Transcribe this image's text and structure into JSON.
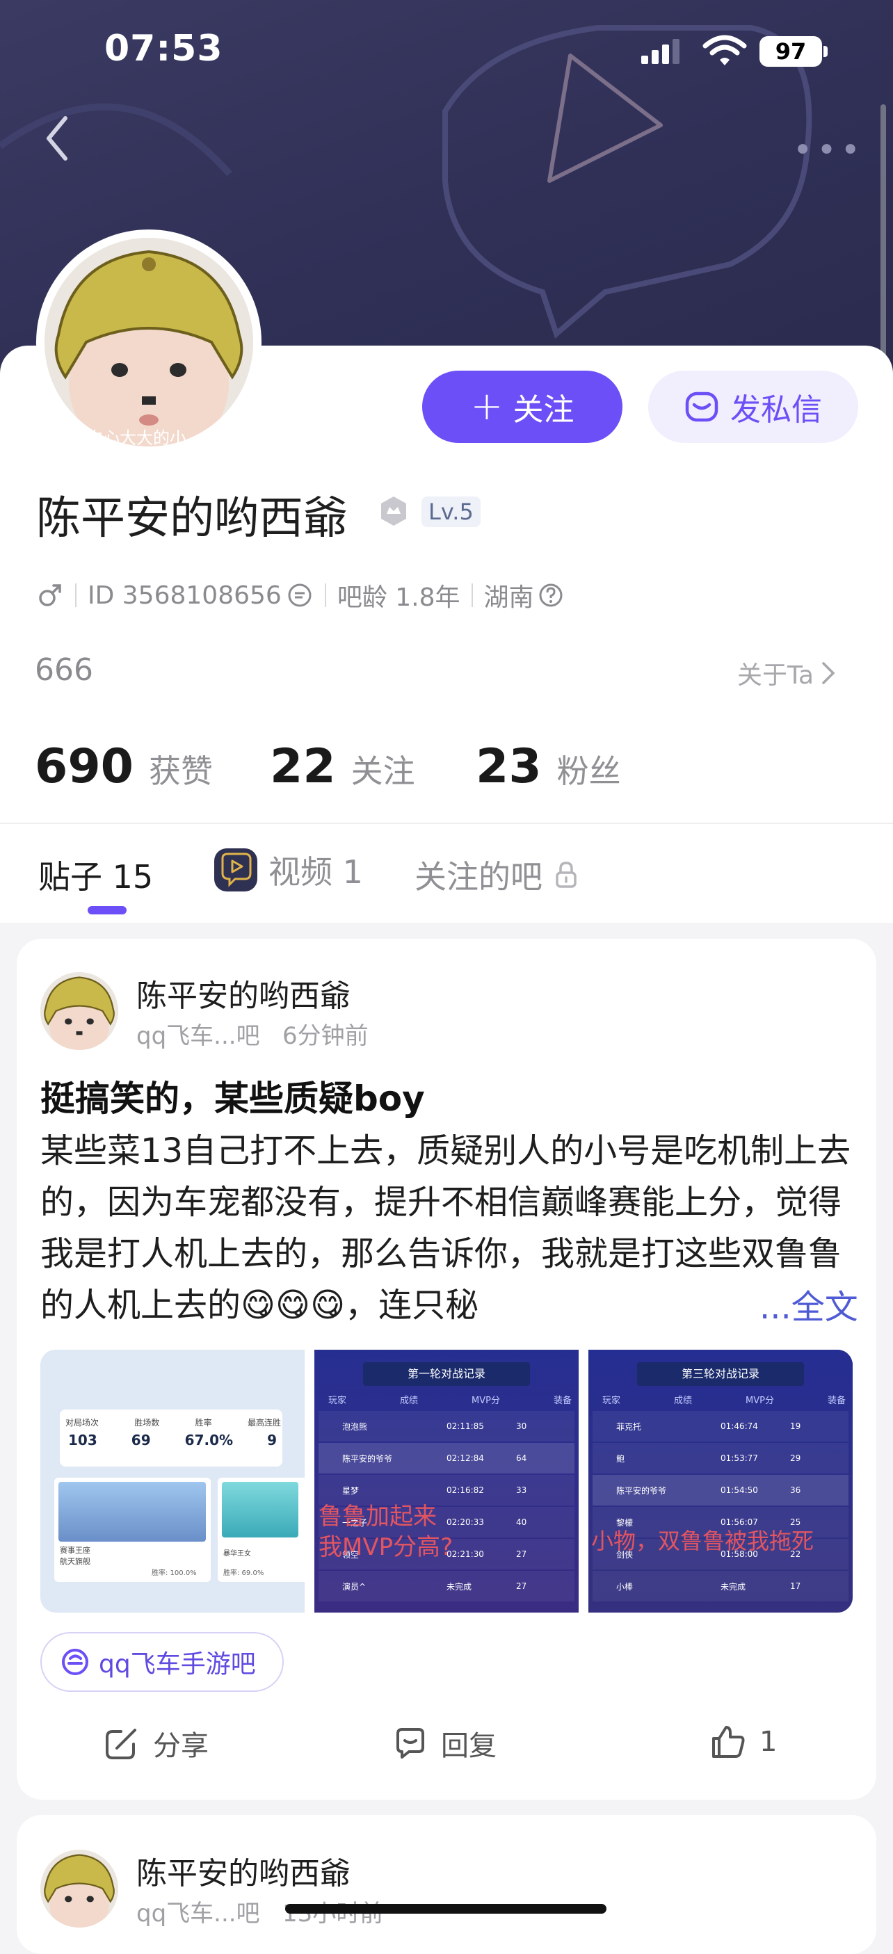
{
  "status_bar": {
    "time": "07:53",
    "battery": "97"
  },
  "profile": {
    "avatar_watermark": "的内心大大的小",
    "name": "陈平安的哟西爺",
    "level": "Lv.5",
    "id_text": "ID 3568108656",
    "age_text": "吧龄 1.8年",
    "location": "湖南",
    "bio": "666",
    "about_label": "关于Ta",
    "follow_label": "关注",
    "message_label": "发私信"
  },
  "stats": [
    {
      "num": "690",
      "label": "获赞"
    },
    {
      "num": "22",
      "label": "关注"
    },
    {
      "num": "23",
      "label": "粉丝"
    }
  ],
  "tabs": {
    "posts": "贴子 15",
    "videos": "视频 1",
    "bars": "关注的吧"
  },
  "post": {
    "author": "陈平安的哟西爺",
    "subline": "qq飞车...吧   6分钟前",
    "title": "挺搞笑的，某些质疑boy",
    "body": "某些菜13自己打不上去，质疑别人的小号是吃机制上去的，因为车宠都没有，提升不相信巅峰赛能上分，觉得我是打人机上去的，那么告诉你，我就是打这些双鲁鲁的人机上去的😋😋😋，连只秘",
    "full_text_label": "...全文",
    "tag": "qq飞车手游吧",
    "share_label": "分享",
    "reply_label": "回复",
    "like_count": "1",
    "images": {
      "img1": {
        "stat_labels": [
          "对局场次",
          "胜场数",
          "胜率",
          "最高连胜"
        ],
        "stat_values": [
          "103",
          "69",
          "67.0%",
          "9"
        ],
        "car_label": "赛事王座",
        "car_sub": "航天旗舰",
        "car_rate": "胜率: 100.0%",
        "pet_sub": "暴华王女",
        "pet_rate": "胜率: 69.0%"
      },
      "img2": {
        "title": "第一轮对战记录",
        "headers": [
          "玩家",
          "成绩",
          "MVP分",
          "装备"
        ],
        "rows": [
          [
            "泡泡熊",
            "02:11:85",
            "30"
          ],
          [
            "陈平安的爷爷",
            "02:12:84",
            "64"
          ],
          [
            "星梦",
            "02:16:82",
            "33"
          ],
          [
            "一之子",
            "02:20:33",
            "40"
          ],
          [
            "领空",
            "02:21:30",
            "27"
          ],
          [
            "演员^",
            "未完成",
            "27"
          ]
        ],
        "overlay": "鲁鲁加起来\n我MVP分高?"
      },
      "img3": {
        "title": "第三轮对战记录",
        "headers": [
          "玩家",
          "成绩",
          "MVP分",
          "装备"
        ],
        "rows": [
          [
            "菲克托",
            "01:46:74",
            "19"
          ],
          [
            "鲍",
            "01:53:77",
            "29"
          ],
          [
            "陈平安的爷爷",
            "01:54:50",
            "36"
          ],
          [
            "黎檬",
            "01:56:07",
            "25"
          ],
          [
            "剑侠",
            "01:58:00",
            "22"
          ],
          [
            "小棒",
            "未完成",
            "17"
          ]
        ],
        "overlay": "小物，双鲁鲁被我拖死"
      }
    }
  },
  "post2": {
    "author": "陈平安的哟西爺",
    "subline": "qq飞车...吧   13小时前"
  },
  "colors": {
    "accent": "#6c4ff6",
    "link": "#4f5bd5",
    "banner": "#303057"
  }
}
